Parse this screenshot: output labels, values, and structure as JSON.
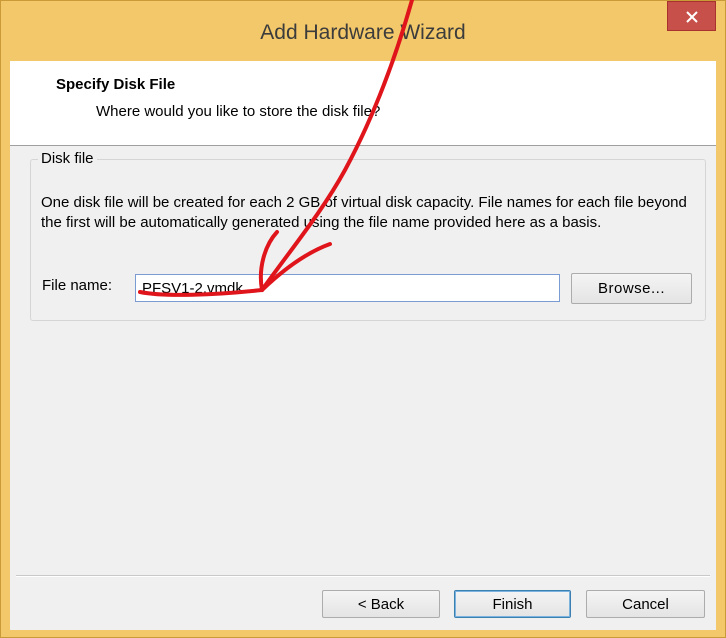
{
  "window": {
    "title": "Add Hardware Wizard"
  },
  "header": {
    "title": "Specify Disk File",
    "subtitle": "Where would you like to store the disk file?"
  },
  "disk_file_group": {
    "label": "Disk file",
    "description": "One disk file will be created for each 2 GB of virtual disk capacity. File names for each file beyond the first will be automatically generated using the file name provided here as a basis.",
    "file_name_label": "File name:",
    "file_name_value": "PFSV1-2.vmdk",
    "browse_label": "Browse..."
  },
  "footer": {
    "back_label": "< Back",
    "finish_label": "Finish",
    "cancel_label": "Cancel"
  },
  "colors": {
    "title_bar": "#f3c86a",
    "close_button": "#c7504a",
    "annotation_arrow": "#e0151b"
  }
}
